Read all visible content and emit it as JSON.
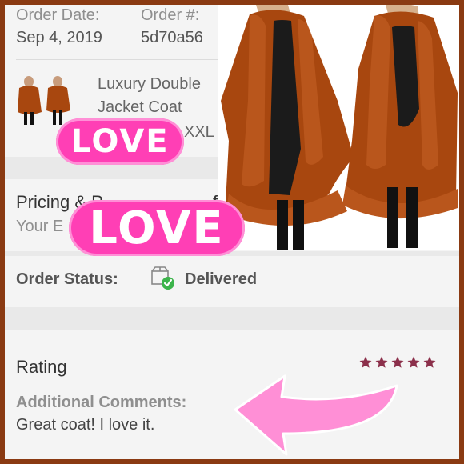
{
  "order": {
    "date_label": "Order Date:",
    "date_value": "Sep 4, 2019",
    "number_label": "Order #:",
    "number_value": "5d70a56"
  },
  "item": {
    "title_line1": "Luxury Double",
    "title_line2": "Jacket Coat",
    "size": "XXL"
  },
  "pricing": {
    "heading": "Pricing & P",
    "heading_tail": "fo",
    "subtext": "Your E"
  },
  "stickers": {
    "small_love": "LOVE",
    "big_love": "LOVE"
  },
  "status": {
    "label": "Order Status:",
    "value": "Delivered",
    "icon": "delivered-box-check-icon",
    "check_color": "#3cb44b"
  },
  "rating": {
    "heading": "Rating",
    "stars": 5,
    "max_stars": 5,
    "star_color": "#8b2f4a"
  },
  "comments": {
    "label": "Additional Comments:",
    "text": "Great coat! I love it."
  },
  "colors": {
    "frame": "#8a3a12",
    "coat": "#a8470f",
    "sticker": "#ff3fb5",
    "arrow": "#ff8fd6"
  }
}
